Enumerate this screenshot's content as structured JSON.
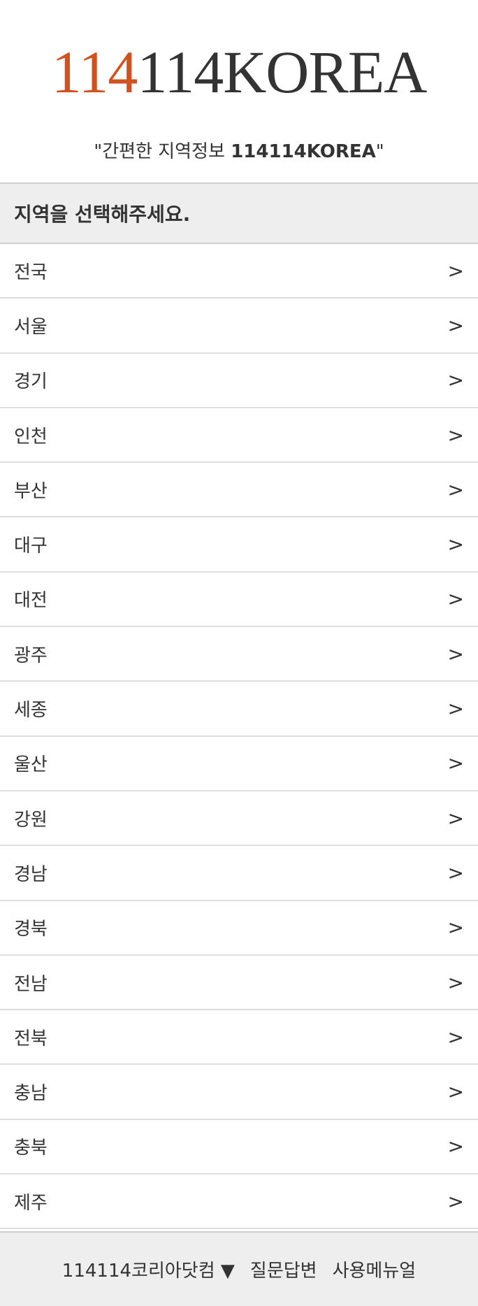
{
  "header": {
    "logo_accent": "114",
    "logo_rest": "114KOREA",
    "tagline_prefix": "\"간편한 지역정보 ",
    "tagline_strong": "114114KOREA",
    "tagline_suffix": "\""
  },
  "section": {
    "title": "지역을 선택해주세요."
  },
  "regions": {
    "chevron": ">",
    "items": [
      "전국",
      "서울",
      "경기",
      "인천",
      "부산",
      "대구",
      "대전",
      "광주",
      "세종",
      "울산",
      "강원",
      "경남",
      "경북",
      "전남",
      "전북",
      "충남",
      "충북",
      "제주"
    ]
  },
  "footer": {
    "site_link": "114114코리아닷컴 ▼",
    "qa_link": "질문답변",
    "manual_link": "사용메뉴얼"
  },
  "colors": {
    "accent": "#d0521f",
    "text": "#333333",
    "band_bg": "#eeeeee"
  }
}
